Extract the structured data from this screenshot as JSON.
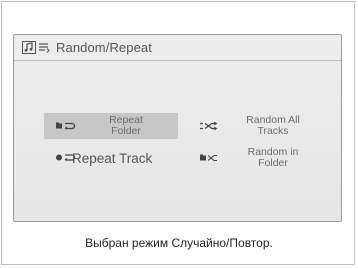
{
  "window": {
    "title": "Random/Repeat",
    "icons": [
      "music-note-icon",
      "repeat-list-icon"
    ]
  },
  "options": [
    {
      "label": "Repeat\nFolder",
      "icon": "repeat-folder-icon",
      "selected": true
    },
    {
      "label": "Random All\nTracks",
      "icon": "shuffle-icon",
      "selected": false
    },
    {
      "label": "Repeat Track",
      "icon": "repeat-track-icon",
      "selected": false
    },
    {
      "label": "Random in\nFolder",
      "icon": "random-folder-icon",
      "selected": false
    }
  ],
  "caption": "Выбран режим Случайно/Повтор."
}
